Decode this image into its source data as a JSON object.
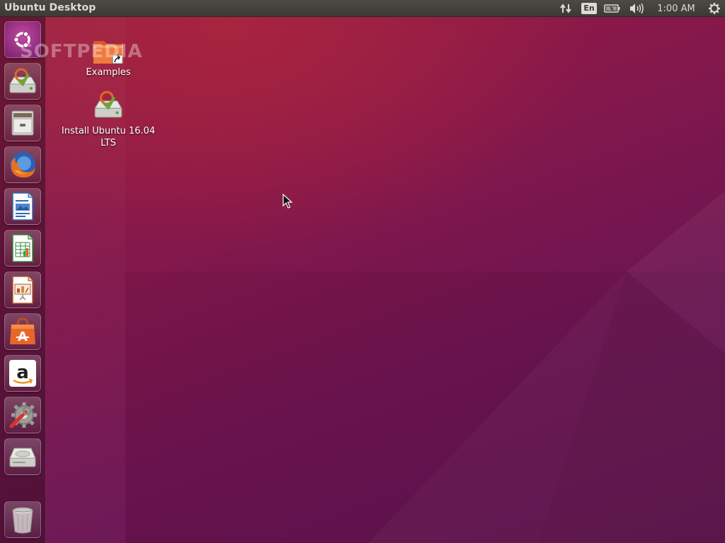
{
  "top_panel": {
    "title": "Ubuntu Desktop",
    "keyboard_layout": "En",
    "clock": "1:00 AM",
    "icons": {
      "network": "network-updown-icon",
      "battery": "battery-icon",
      "sound": "volume-icon",
      "session": "gear-icon"
    }
  },
  "launcher": {
    "items": [
      {
        "name": "dash",
        "icon": "ubuntu-logo-icon"
      },
      {
        "name": "install-ubuntu",
        "icon": "installer-drive-icon"
      },
      {
        "name": "files",
        "icon": "file-cabinet-icon"
      },
      {
        "name": "firefox",
        "icon": "firefox-icon"
      },
      {
        "name": "libreoffice-writer",
        "icon": "writer-document-icon"
      },
      {
        "name": "libreoffice-calc",
        "icon": "calc-spreadsheet-icon"
      },
      {
        "name": "libreoffice-impress",
        "icon": "impress-presentation-icon"
      },
      {
        "name": "software-center",
        "icon": "shopping-bag-icon"
      },
      {
        "name": "amazon",
        "icon": "amazon-icon"
      },
      {
        "name": "system-settings",
        "icon": "settings-wrench-icon"
      },
      {
        "name": "drive",
        "icon": "hard-drive-icon"
      },
      {
        "name": "trash",
        "icon": "trash-icon"
      }
    ]
  },
  "desktop": {
    "icons": [
      {
        "label": "Examples",
        "icon": "folder-link-icon"
      },
      {
        "label": "Install Ubuntu 16.04 LTS",
        "icon": "installer-drive-icon"
      }
    ]
  },
  "watermark": "SOFTPEDIA"
}
